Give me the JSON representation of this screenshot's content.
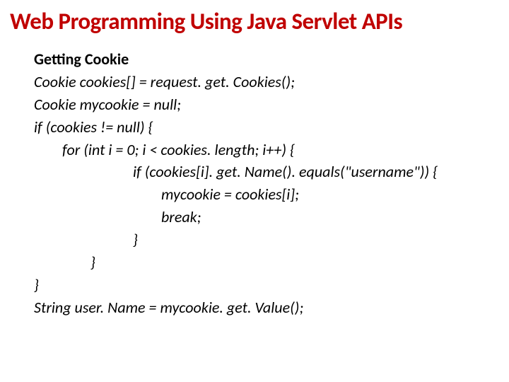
{
  "title": "Web Programming Using Java Servlet APIs",
  "heading": "Getting Cookie",
  "lines": {
    "l1": "Cookie cookies[] = request. get. Cookies();",
    "l2": "Cookie mycookie = null;",
    "l3": "if (cookies != null) {",
    "l4": "for (int i = 0; i < cookies. length; i++) {",
    "l5": "if (cookies[i]. get. Name(). equals(\"username\")) {",
    "l6": "mycookie = cookies[i];",
    "l7": "break;",
    "l8": "}",
    "l9": "}",
    "l10": "}",
    "l11": "String user. Name = mycookie. get. Value();"
  }
}
